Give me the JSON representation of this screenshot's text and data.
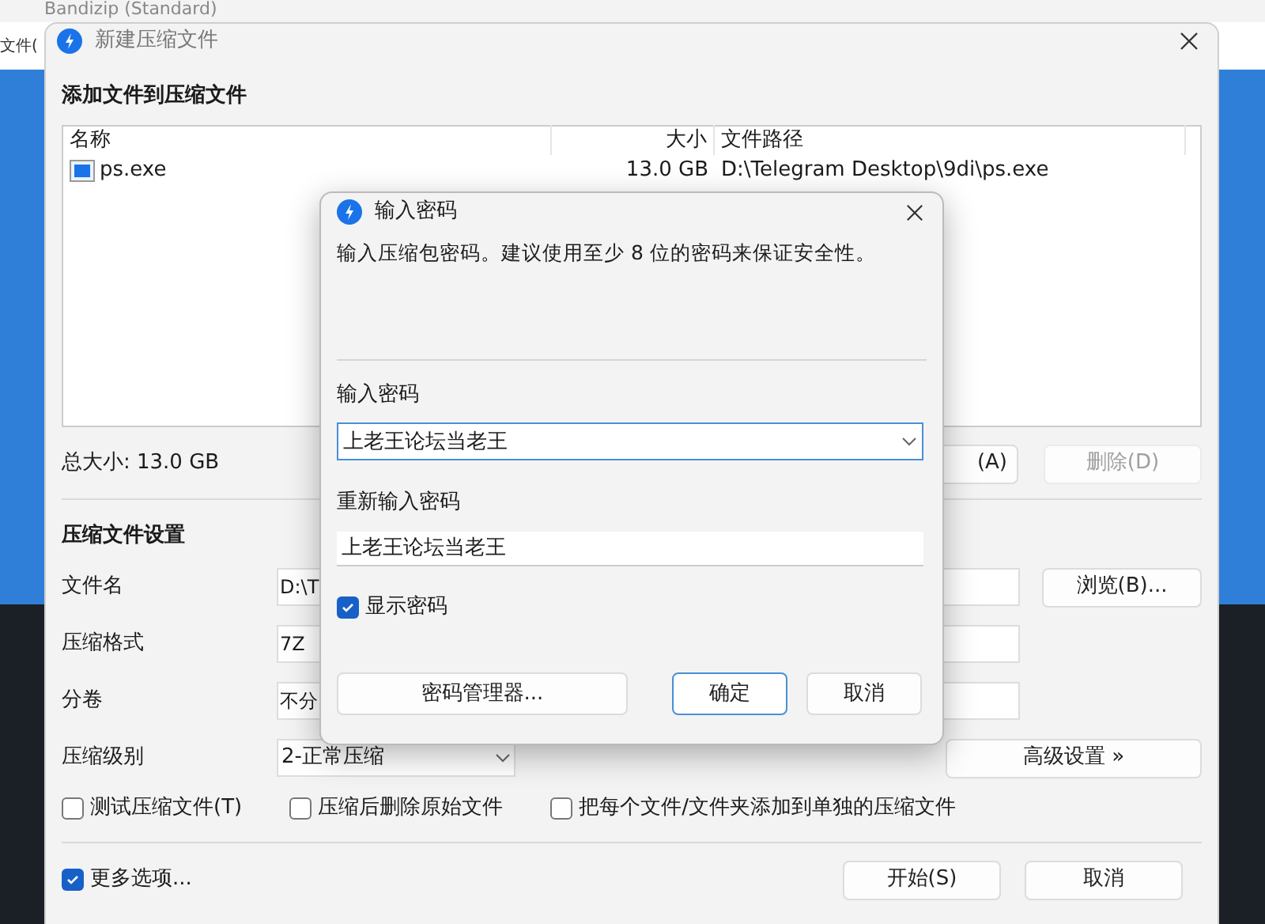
{
  "back_window": {
    "title": "Bandizip (Standard)",
    "menu": [
      "文件("
    ]
  },
  "window": {
    "title": "新建压缩文件",
    "heading": "添加文件到压缩文件",
    "file_list": {
      "columns": [
        "名称",
        "大小",
        "文件路径"
      ],
      "rows": [
        {
          "name": "ps.exe",
          "size": "13.0 GB",
          "path": "D:\\Telegram Desktop\\9di\\ps.exe"
        }
      ]
    },
    "total_size": "总大小: 13.0 GB",
    "list_buttons": [
      {
        "label": "(A)",
        "disabled": false
      },
      {
        "label": "删除(D)",
        "disabled": true
      }
    ],
    "settings_heading": "压缩文件设置",
    "settings": [
      {
        "label": "文件名",
        "value": "D:\\T",
        "kind": "text",
        "button": "浏览(B)..."
      },
      {
        "label": "压缩格式",
        "value": "7Z",
        "kind": "text"
      },
      {
        "label": "分卷",
        "value": "不分",
        "kind": "text"
      },
      {
        "label": "压缩级别",
        "value": "2-正常压缩",
        "kind": "dropdown",
        "button": "高级设置 »"
      }
    ],
    "options": [
      {
        "label": "测试压缩文件(T)",
        "checked": false
      },
      {
        "label": "压缩后删除原始文件",
        "checked": false
      },
      {
        "label": "把每个文件/文件夹添加到单独的压缩文件",
        "checked": false
      }
    ],
    "more_options": {
      "label": "更多选项...",
      "checked": true
    },
    "buttons": [
      {
        "label": "开始(S)"
      },
      {
        "label": "取消"
      }
    ]
  },
  "dialog": {
    "title": "输入密码",
    "description": "输入压缩包密码。建议使用至少 8 位的密码来保证安全性。",
    "password_label": "输入密码",
    "password": "上老王论坛当老王",
    "confirm_label": "重新输入密码",
    "confirm": "上老王论坛当老王",
    "show_password": {
      "label": "显示密码",
      "checked": true
    },
    "manager_button": "密码管理器...",
    "buttons": [
      {
        "label": "确定",
        "default": true
      },
      {
        "label": "取消",
        "default": false
      }
    ]
  }
}
